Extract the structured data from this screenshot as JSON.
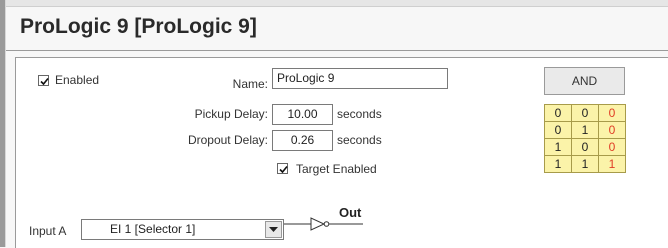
{
  "title": "ProLogic 9 [ProLogic 9]",
  "enabled": {
    "label": "Enabled",
    "checked": true
  },
  "name": {
    "label": "Name:",
    "value": "ProLogic 9"
  },
  "pickup_delay": {
    "label": "Pickup Delay:",
    "value": "10.00",
    "unit": "seconds"
  },
  "dropout_delay": {
    "label": "Dropout Delay:",
    "value": "0.26",
    "unit": "seconds"
  },
  "target_enabled": {
    "label": "Target Enabled",
    "checked": true
  },
  "gate": {
    "type_label": "AND"
  },
  "truth_table": [
    [
      "0",
      "0",
      "0"
    ],
    [
      "0",
      "1",
      "0"
    ],
    [
      "1",
      "0",
      "0"
    ],
    [
      "1",
      "1",
      "1"
    ]
  ],
  "input_a": {
    "label": "Input A",
    "value": "EI 1 [Selector 1]"
  },
  "output": {
    "label": "Out"
  },
  "colors": {
    "table_fill": "#fbf3a9",
    "output_text": "#e03d25",
    "panel_bg": "#ffffff"
  },
  "icons": [
    "check-icon",
    "chevron-down-icon",
    "buffer-gate-icon"
  ]
}
